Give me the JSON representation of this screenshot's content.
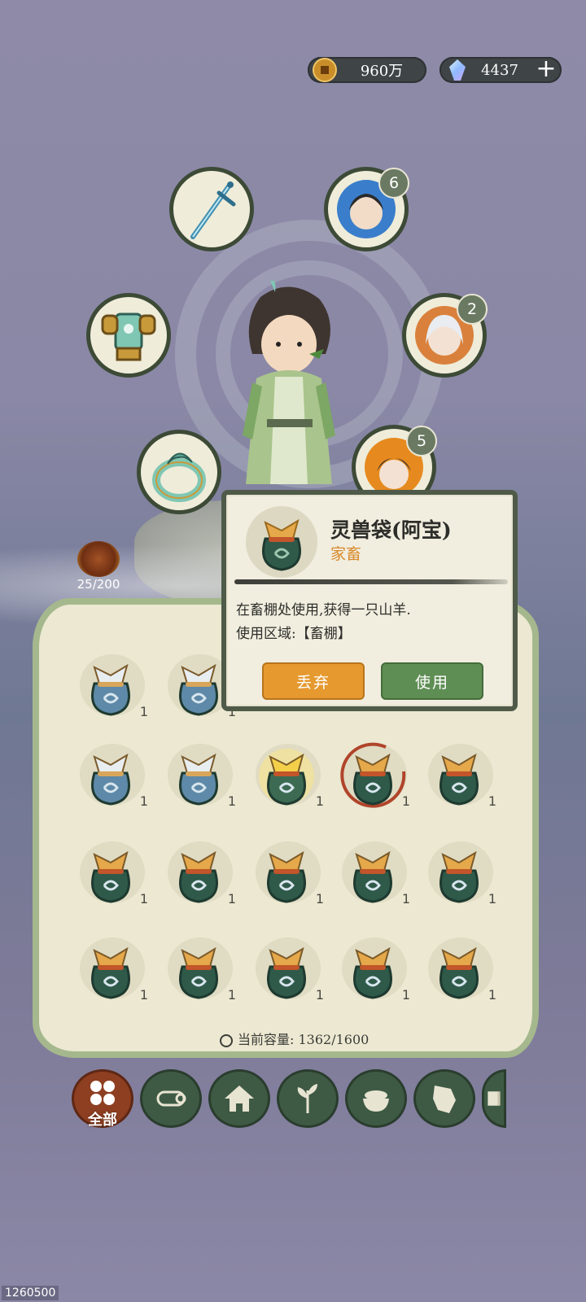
{
  "currency": {
    "coins": "960万",
    "gems": "4437",
    "add_label": "+"
  },
  "equipment": [
    {
      "id": "weapon",
      "icon": "sword-icon",
      "badge": null
    },
    {
      "id": "companion-1",
      "icon": "maiden-portrait-icon",
      "badge": "6"
    },
    {
      "id": "armor",
      "icon": "armor-icon",
      "badge": null
    },
    {
      "id": "companion-2",
      "icon": "elder-portrait-icon",
      "badge": "2"
    },
    {
      "id": "ring",
      "icon": "jade-ring-icon",
      "badge": null
    },
    {
      "id": "companion-3",
      "icon": "fire-spirit-portrait-icon",
      "badge": "5"
    }
  ],
  "pet_level": "25/200",
  "tooltip": {
    "name": "灵兽袋(阿宝)",
    "category": "家畜",
    "description_line1": "在畜棚处使用,获得一只山羊.",
    "description_line2": "使用区域:【畜棚】",
    "drop_label": "丢弃",
    "use_label": "使用"
  },
  "inventory": {
    "items": [
      {
        "type": "blue",
        "qty": "1"
      },
      {
        "type": "blue",
        "qty": "1"
      },
      {
        "type": "blue",
        "qty": "1"
      },
      {
        "type": "blue",
        "qty": "1"
      },
      {
        "type": "gold",
        "qty": "1"
      },
      {
        "type": "selected",
        "qty": "1"
      },
      {
        "type": "green",
        "qty": "1"
      },
      {
        "type": "green",
        "qty": "1"
      },
      {
        "type": "green",
        "qty": "1"
      },
      {
        "type": "green",
        "qty": "1"
      },
      {
        "type": "green",
        "qty": "1"
      },
      {
        "type": "green",
        "qty": "1"
      },
      {
        "type": "green",
        "qty": "1"
      },
      {
        "type": "green",
        "qty": "1"
      },
      {
        "type": "green",
        "qty": "1"
      },
      {
        "type": "green",
        "qty": "1"
      },
      {
        "type": "green",
        "qty": "1"
      }
    ],
    "capacity_label": "当前容量:",
    "capacity_value": "1362/1600"
  },
  "tabs": [
    {
      "id": "all",
      "label": "全部",
      "icon": "grid-icon"
    },
    {
      "id": "wood",
      "icon": "log-icon"
    },
    {
      "id": "building",
      "icon": "hut-icon"
    },
    {
      "id": "plant",
      "icon": "sprout-icon"
    },
    {
      "id": "food",
      "icon": "rice-bowl-icon"
    },
    {
      "id": "map",
      "icon": "map-icon"
    },
    {
      "id": "scroll",
      "icon": "scroll-icon"
    }
  ],
  "footer_id": "1260500",
  "colors": {
    "accent_orange": "#e5992f",
    "accent_green": "#5f8e54",
    "panel_bg": "#ece8d2",
    "panel_border": "#a5b88d"
  }
}
